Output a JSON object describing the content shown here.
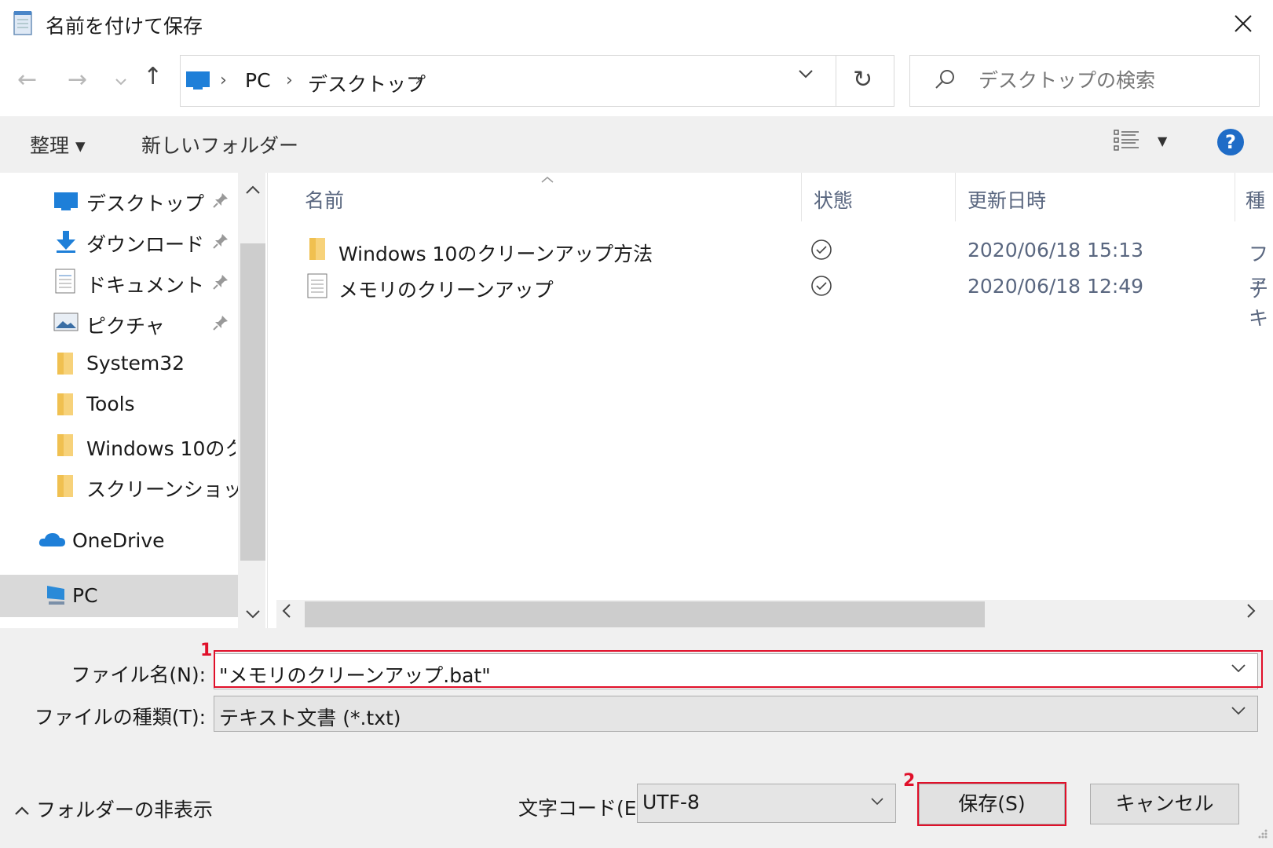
{
  "window": {
    "title": "名前を付けて保存",
    "icon": "notepad-icon"
  },
  "nav": {
    "breadcrumb": [
      "PC",
      "デスクトップ"
    ],
    "search_placeholder": "デスクトップの検索"
  },
  "toolbar": {
    "organize_label": "整理 ▾",
    "new_folder_label": "新しいフォルダー",
    "help_label": "?"
  },
  "sidebar": {
    "items": [
      {
        "label": "デスクトップ",
        "icon": "desktop-icon",
        "pinned": true
      },
      {
        "label": "ダウンロード",
        "icon": "download-icon",
        "pinned": true
      },
      {
        "label": "ドキュメント",
        "icon": "document-icon",
        "pinned": true
      },
      {
        "label": "ピクチャ",
        "icon": "picture-icon",
        "pinned": true
      },
      {
        "label": "System32",
        "icon": "folder-icon",
        "pinned": false
      },
      {
        "label": "Tools",
        "icon": "folder-icon",
        "pinned": false
      },
      {
        "label": "Windows 10のクリ",
        "icon": "folder-icon",
        "pinned": false
      },
      {
        "label": "スクリーンショット",
        "icon": "folder-icon",
        "pinned": false
      }
    ],
    "onedrive_label": "OneDrive",
    "pc_label": "PC"
  },
  "file_list": {
    "columns": [
      "名前",
      "状態",
      "更新日時",
      "種"
    ],
    "rows": [
      {
        "name": "Windows 10のクリーンアップ方法",
        "icon": "folder-icon",
        "status": "synced",
        "date": "2020/06/18 15:13",
        "type": "ファ"
      },
      {
        "name": "メモリのクリーンアップ",
        "icon": "text-file-icon",
        "status": "synced",
        "date": "2020/06/18 12:49",
        "type": "テキ"
      }
    ]
  },
  "form": {
    "filename_label": "ファイル名(N):",
    "filename_value": "\"メモリのクリーンアップ.bat\"",
    "filetype_label": "ファイルの種類(T):",
    "filetype_value": "テキスト文書 (*.txt)",
    "encoding_label": "文字コード(E):",
    "encoding_value": "UTF-8",
    "hide_folders_label": "フォルダーの非表示",
    "save_label": "保存(S)",
    "cancel_label": "キャンセル"
  },
  "annotations": {
    "step1": "1",
    "step2": "2",
    "highlight_color": "#e0102a"
  }
}
